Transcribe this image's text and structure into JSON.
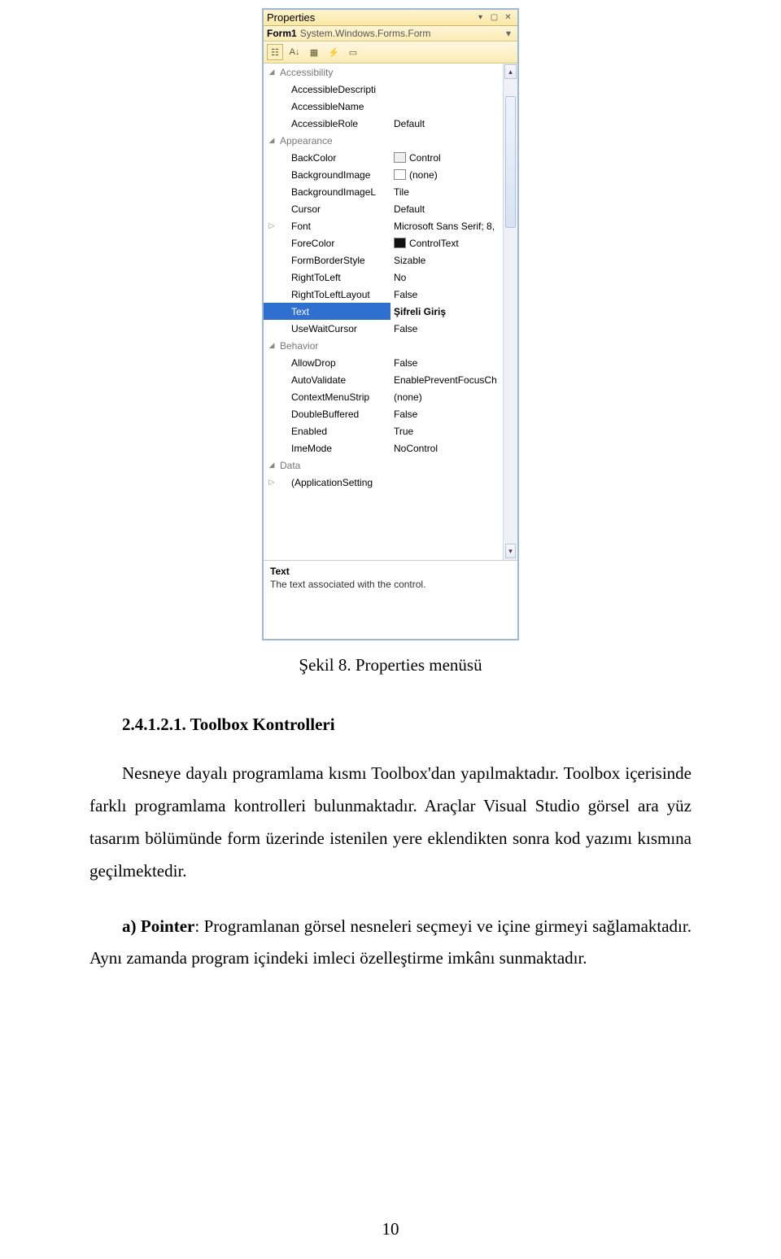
{
  "properties_panel": {
    "title": "Properties",
    "selector": {
      "object_name": "Form1",
      "object_type": "System.Windows.Forms.Form"
    },
    "description": {
      "title": "Text",
      "text": "The text associated with the control."
    },
    "categories": [
      {
        "name": "Accessibility",
        "expanded": true,
        "items": [
          {
            "label": "AccessibleDescripti",
            "value": ""
          },
          {
            "label": "AccessibleName",
            "value": ""
          },
          {
            "label": "AccessibleRole",
            "value": "Default"
          }
        ]
      },
      {
        "name": "Appearance",
        "expanded": true,
        "items": [
          {
            "label": "BackColor",
            "value": "Control",
            "swatch": "light"
          },
          {
            "label": "BackgroundImage",
            "value": "(none)",
            "swatch": "none"
          },
          {
            "label": "BackgroundImageL",
            "value": "Tile"
          },
          {
            "label": "Cursor",
            "value": "Default"
          },
          {
            "label": "Font",
            "value": "Microsoft Sans Serif; 8,",
            "expandable": true
          },
          {
            "label": "ForeColor",
            "value": "ControlText",
            "swatch": "dark"
          },
          {
            "label": "FormBorderStyle",
            "value": "Sizable"
          },
          {
            "label": "RightToLeft",
            "value": "No"
          },
          {
            "label": "RightToLeftLayout",
            "value": "False"
          },
          {
            "label": "Text",
            "value": "Şifreli Giriş",
            "selected": true
          },
          {
            "label": "UseWaitCursor",
            "value": "False"
          }
        ]
      },
      {
        "name": "Behavior",
        "expanded": true,
        "items": [
          {
            "label": "AllowDrop",
            "value": "False"
          },
          {
            "label": "AutoValidate",
            "value": "EnablePreventFocusCh"
          },
          {
            "label": "ContextMenuStrip",
            "value": "(none)"
          },
          {
            "label": "DoubleBuffered",
            "value": "False"
          },
          {
            "label": "Enabled",
            "value": "True"
          },
          {
            "label": "ImeMode",
            "value": "NoControl"
          }
        ]
      },
      {
        "name": "Data",
        "expanded": true,
        "items": [
          {
            "label": "(ApplicationSetting",
            "value": "",
            "expandable": true
          }
        ]
      }
    ]
  },
  "doc": {
    "caption": "Şekil 8. Properties menüsü",
    "heading": "2.4.1.2.1. Toolbox Kontrolleri",
    "para1": "Nesneye dayalı programlama kısmı Toolbox'dan yapılmaktadır. Toolbox içerisinde farklı programlama kontrolleri bulunmaktadır. Araçlar Visual Studio görsel ara yüz tasarım bölümünde form üzerinde istenilen yere eklendikten sonra kod yazımı kısmına geçilmektedir.",
    "para2_label": "a) Pointer",
    "para2_rest": ": Programlanan görsel nesneleri seçmeyi ve içine girmeyi sağlamaktadır. Aynı zamanda program içindeki imleci özelleştirme imkânı sunmaktadır.",
    "page_number": "10"
  }
}
